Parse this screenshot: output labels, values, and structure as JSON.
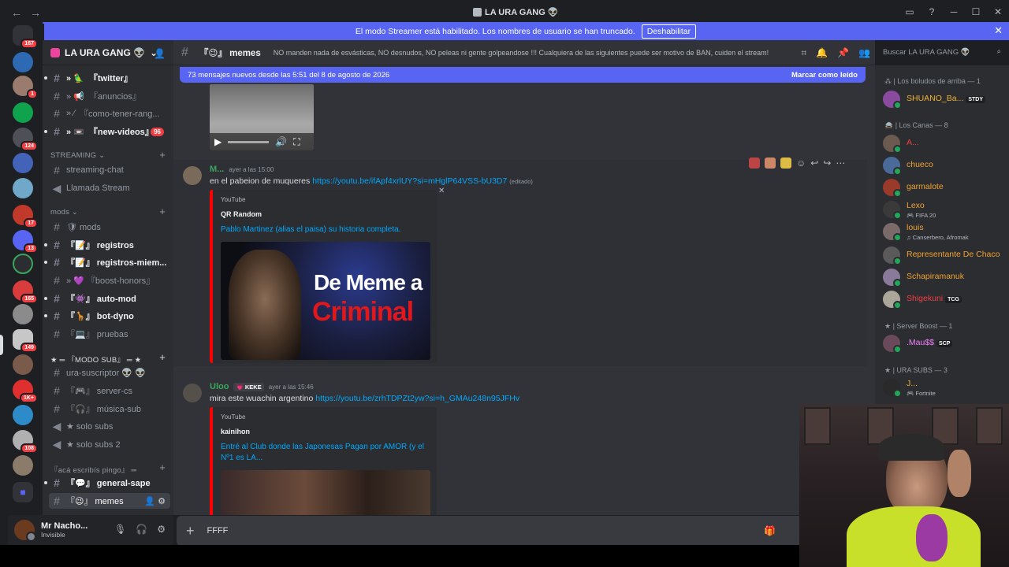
{
  "window": {
    "title": "LA URA GANG 👽"
  },
  "streamer_banner": {
    "text": "El modo Streamer está habilitado. Los nombres de usuario se han truncado.",
    "button": "Deshabilitar"
  },
  "server_rail": {
    "badges": [
      "167",
      "1",
      "124",
      "17",
      "13",
      "165",
      "149",
      "1K+",
      "108"
    ]
  },
  "guild": {
    "name": "LA URA GANG 👽"
  },
  "channels_top": [
    {
      "label": "『twitter』",
      "prefix": "» 🦜",
      "unread": true
    },
    {
      "label": "『anuncios』",
      "prefix": "» 📢",
      "unread": false
    },
    {
      "label": "『como-tener-rang...",
      "prefix": "» ⁄",
      "unread": false
    },
    {
      "label": "『new-videos』",
      "prefix": "» 📼",
      "unread": true,
      "count": "96"
    }
  ],
  "cat_streaming": "STREAMING",
  "channels_streaming": [
    {
      "label": "streaming-chat",
      "type": "text"
    },
    {
      "label": "Llamada Stream",
      "type": "voice"
    }
  ],
  "cat_mods": "mods",
  "channels_mods": [
    {
      "label": "🛡 mods",
      "type": "text",
      "unread": false
    },
    {
      "label": "『📝』 registros",
      "type": "text",
      "unread": true
    },
    {
      "label": "『📝』 registros-miem...",
      "type": "text",
      "unread": true
    },
    {
      "label": "» 💜 『boost-honors』",
      "type": "text",
      "unread": false
    },
    {
      "label": "『👾』 auto-mod",
      "type": "text",
      "unread": true
    },
    {
      "label": "『🦒』 bot-dyno",
      "type": "text",
      "unread": true
    },
    {
      "label": "『💻』 pruebas",
      "type": "text",
      "unread": false
    }
  ],
  "cat_subs": "★ ═ 『MODO SUB』 ═ ★",
  "channels_subs": [
    {
      "label": "ura-suscriptor 👽 👽",
      "type": "text"
    },
    {
      "label": "『🎮』 server-cs",
      "type": "text"
    },
    {
      "label": "『🎧』 música-sub",
      "type": "text"
    },
    {
      "label": "★ solo subs",
      "type": "voice"
    },
    {
      "label": "★ solo subs 2",
      "type": "voice"
    }
  ],
  "cat_write": "『acá escribís pingo』 ═",
  "channels_write": [
    {
      "label": "『💬』 general-sape",
      "type": "text",
      "unread": true
    },
    {
      "label": "『😉』 memes",
      "type": "text",
      "active": true
    }
  ],
  "user": {
    "name": "Mr Nacho...",
    "status": "Invisible"
  },
  "channel_header": {
    "name": "『😉』 memes",
    "topic": "NO manden nada de esvásticas, NO desnudos, NO peleas ni gente golpeandose !!! Cualquiera de las siguientes puede ser motivo de BAN, cuiden el stream!"
  },
  "search": {
    "placeholder": "Buscar LA URA GANG 👽"
  },
  "new_messages": {
    "text": "73 mensajes nuevos desde las 5:51 del 8 de agosto de 2026",
    "mark": "Marcar como leído"
  },
  "messages": [
    {
      "user": "M...",
      "time": "ayer a las 15:00",
      "text": "en el pabeion de muqueres",
      "link": "https://youtu.be/ifApf4xrlUY?si=mHglP64VSS-bU3D7",
      "edited": "(editado)",
      "embed": {
        "provider": "YouTube",
        "author": "QR Random",
        "title": "Pablo Martinez (alias el paisa) su historia completa.",
        "thumb_line1": "De Meme a",
        "thumb_line2": "Criminal"
      }
    },
    {
      "user": "Uloo",
      "tag": "💗 KEKE",
      "time": "ayer a las 15:46",
      "text": "mira este wuachin argentino",
      "link": "https://youtu.be/zrhTDPZt2yw?si=h_GMAu248n95JFHv",
      "embed": {
        "provider": "YouTube",
        "author": "kainihon",
        "title": "Entré al Club donde las Japonesas Pagan por AMOR (y el Nº1 es LA..."
      }
    }
  ],
  "composer": {
    "value": "FFFF"
  },
  "members": {
    "groups": [
      {
        "label": "⁂ | Los boludos de arriba — 1",
        "members": [
          {
            "name": "SHUANO_Ba...",
            "tag": "STDY",
            "color": "#f0b232"
          }
        ]
      },
      {
        "label": "🚔 | Los Canas — 8",
        "members": [
          {
            "name": "A...",
            "color": "#f23f43"
          },
          {
            "name": "chueco",
            "color": "#f0a232"
          },
          {
            "name": "garmalote",
            "color": "#f0a232"
          },
          {
            "name": "Lexo",
            "sub": "🎮 FIFA 20",
            "color": "#f0a232"
          },
          {
            "name": "louis",
            "sub": "♫ Canserbero, Afromak",
            "color": "#f0a232"
          },
          {
            "name": "Representante De Chaco",
            "color": "#f0a232"
          },
          {
            "name": "Schapiramanuk",
            "color": "#f0a232"
          },
          {
            "name": "Shigekuni",
            "tag": "TCG",
            "color": "#f23f43"
          }
        ]
      },
      {
        "label": "★ | Server Boost — 1",
        "members": [
          {
            "name": ".Mau$$",
            "tag": "SCP",
            "color": "#f47fff"
          }
        ]
      },
      {
        "label": "★ | URA SUBS — 3",
        "members": [
          {
            "name": "J...",
            "sub": "🎮 Fortnite",
            "color": "#f0b232"
          }
        ]
      }
    ]
  },
  "colors": {
    "accent": "#5865f2",
    "link": "#00a8fc",
    "danger": "#f23f43",
    "online": "#23a55a",
    "youtube": "#ff0000"
  }
}
